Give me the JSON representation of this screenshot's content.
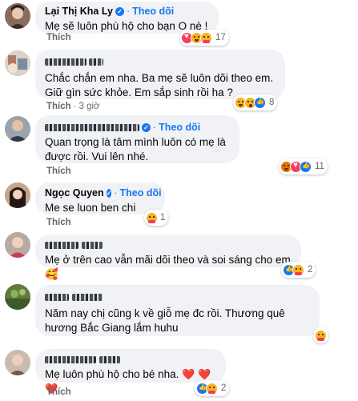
{
  "follow_label": "Theo dõi",
  "like_label": "Thích",
  "comments": [
    {
      "author": "Lại Thị Kha Ly",
      "verified": true,
      "text": "Mẹ sẽ luôn phù hộ cho bạn O nè !",
      "time": "",
      "reactions": [
        "love",
        "haha",
        "care"
      ],
      "count": "17"
    },
    {
      "author": "",
      "verified": false,
      "text": "Chắc chắn em nha. Ba mẹ sẽ luôn dõi theo em. Giữ gìn sức khỏe. Em sắp sinh rồi ha ?",
      "time": "3 giờ",
      "reactions": [
        "haha",
        "wow",
        "like"
      ],
      "count": "8"
    },
    {
      "author": "",
      "verified": false,
      "text": "Quan trọng là tâm mình luôn có mẹ là được rồi. Vui lên nhé.",
      "time": "",
      "reactions": [
        "angry",
        "love",
        "like"
      ],
      "count": "11"
    },
    {
      "author": "Ngọc Quyen",
      "verified": true,
      "text": "Me se luon ben chi",
      "time": "",
      "reactions": [
        "care"
      ],
      "count": "1"
    },
    {
      "author": "",
      "verified": false,
      "text": "Mẹ ở trên cao vẫn mãi dõi theo và soi sáng cho em 🥰",
      "time": "",
      "reactions": [
        "like",
        "care"
      ],
      "count": "2"
    },
    {
      "author": "",
      "verified": false,
      "text": "Năm nay chị cũng k về giỗ mẹ đc rồi. Thương quê hương Bắc Giang lắm huhu",
      "time": "",
      "reactions": [
        "care"
      ],
      "count": ""
    },
    {
      "author": "",
      "verified": false,
      "text": "Mẹ luôn phù hộ cho bé nha.",
      "hearts": "❤️ ❤️ ❤️",
      "time": "",
      "reactions": [
        "like",
        "care"
      ],
      "count": "2"
    }
  ]
}
